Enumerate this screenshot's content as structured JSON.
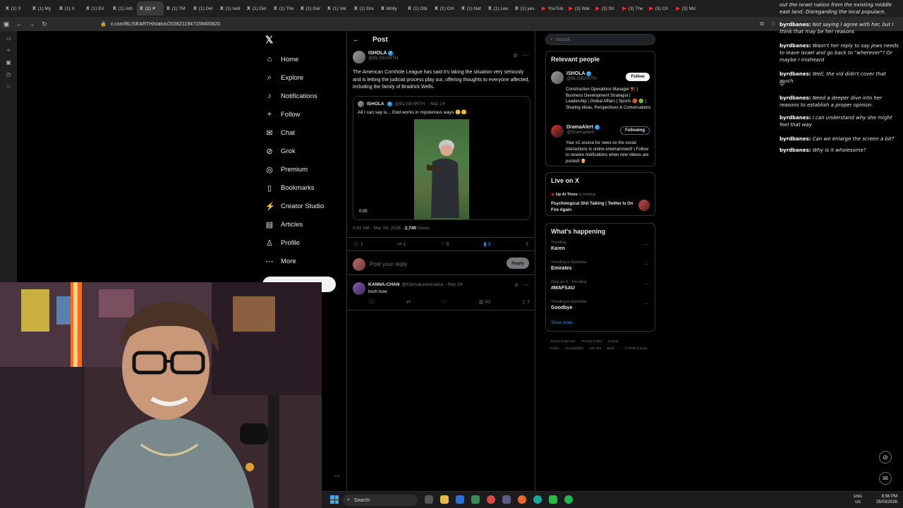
{
  "browser": {
    "tabs": [
      {
        "icon": "X",
        "label": "(1) X"
      },
      {
        "icon": "X",
        "label": "(1) My"
      },
      {
        "icon": "X",
        "label": "(1) X"
      },
      {
        "icon": "X",
        "label": "(1) Eri"
      },
      {
        "icon": "X",
        "label": "(1) Joh"
      },
      {
        "icon": "X",
        "label": "(1) ✕",
        "active": true
      },
      {
        "icon": "X",
        "label": "(1) TM"
      },
      {
        "icon": "X",
        "label": "(1) Del"
      },
      {
        "icon": "X",
        "label": "(1) redi"
      },
      {
        "icon": "X",
        "label": "(1) Del"
      },
      {
        "icon": "X",
        "label": "(1) The"
      },
      {
        "icon": "X",
        "label": "(1) Ger"
      },
      {
        "icon": "X",
        "label": "(1) Val"
      },
      {
        "icon": "X",
        "label": "(1) Dre"
      },
      {
        "icon": "X",
        "label": "Molly"
      },
      {
        "icon": "X",
        "label": "(1) Obi"
      },
      {
        "icon": "X",
        "label": "(1) Om"
      },
      {
        "icon": "X",
        "label": "(1) Nat"
      },
      {
        "icon": "X",
        "label": "(1) Lee"
      },
      {
        "icon": "X",
        "label": "(1) yes"
      },
      {
        "icon": "▶",
        "label": "YouTub",
        "yt": true
      },
      {
        "icon": "▶",
        "label": "(3) War",
        "yt": true
      },
      {
        "icon": "▶",
        "label": "(3) Str",
        "yt": true
      },
      {
        "icon": "▶",
        "label": "(3) The",
        "yt": true
      },
      {
        "icon": "▶",
        "label": "(3) Ch",
        "yt": true
      },
      {
        "icon": "▶",
        "label": "(3) Mic",
        "yt": true
      }
    ],
    "url": "x.com/BLISEARTH/status/2036211947159400820"
  },
  "nav": {
    "logo": "𝕏",
    "items": [
      {
        "icon": "⌂",
        "label": "Home"
      },
      {
        "icon": "⌕",
        "label": "Explore"
      },
      {
        "icon": "♪",
        "label": "Notifications"
      },
      {
        "icon": "+",
        "label": "Follow"
      },
      {
        "icon": "✉",
        "label": "Chat"
      },
      {
        "icon": "⊘",
        "label": "Grok"
      },
      {
        "icon": "◎",
        "label": "Premium"
      },
      {
        "icon": "▯",
        "label": "Bookmarks"
      },
      {
        "icon": "⚡",
        "label": "Creator Studio"
      },
      {
        "icon": "▤",
        "label": "Articles"
      },
      {
        "icon": "♙",
        "label": "Profile"
      },
      {
        "icon": "⋯",
        "label": "More"
      }
    ],
    "post_label": "Post"
  },
  "post": {
    "header_title": "Post",
    "author_name": "ISHOLA",
    "author_handle": "@BLISEARTH",
    "text": "The American Cornhole League has said it's taking the situation very seriously and is letting the judicial process play out, offering thoughts to everyone affected, including the family of Bradrick Wells.",
    "quote": {
      "author_name": "ISHOLA",
      "author_handle": "@BLISEARTH",
      "date": "· Mar 24",
      "text": "All I can say is... God works in mysterious ways 🙂🙂",
      "duration": "0:05"
    },
    "timestamp": "8:42 AM · Mar 24, 2026 · ",
    "views_count": "2,740",
    "views_label": " Views",
    "stats": {
      "replies": "1",
      "reposts": "1",
      "likes": "8",
      "bookmarks": "3"
    },
    "reply_placeholder": "Post your reply",
    "reply_button": "Reply",
    "reply": {
      "author_name": "KANNA-CHAN",
      "author_handle": "@Kannakamuisama",
      "date": "· Mar 24",
      "text": "bruh how",
      "views": "43"
    }
  },
  "sidebar": {
    "search_placeholder": "Search",
    "relevant_title": "Relevant people",
    "people": [
      {
        "name": "ISHOLA",
        "handle": "@BLISEARTH",
        "bio": "Construction Operations Manager 🏗️ | Business Development Strategist | Leadership | Global Affairs | Sports 🏀 🟢 | Sharing Ideas, Perspectives & Conversations",
        "button": "Follow"
      },
      {
        "name": "DramaAlert",
        "handle": "@DramaAlert",
        "bio": "Your #1 source for news on the social interactions in online entertainment! | Follow to receive notifications when new videos are posted! 🍿",
        "button": "Following"
      }
    ],
    "live_title": "Live on X",
    "live": {
      "host": "Up At Three",
      "hosting": "is hosting",
      "title": "Psychological Shit Talking | Twitter Is On Fire Again"
    },
    "happening_title": "What's happening",
    "trends": [
      {
        "context": "Trending",
        "name": "Karen"
      },
      {
        "context": "Trending in Australia",
        "name": "Emirates"
      },
      {
        "context": "Only on X · Trending",
        "name": "#MAFSAU"
      },
      {
        "context": "Trending in Australia",
        "name": "Goodbye"
      }
    ],
    "show_more": "Show more",
    "footer": [
      "Terms of Service",
      "Privacy Policy",
      "Cookie Policy",
      "Accessibility",
      "Ads info",
      "More ···",
      "© 2026 X Corp."
    ]
  },
  "chat": [
    {
      "user": "",
      "text": "out the israel nation from the existing middle east land. Disregarding the local populace."
    },
    {
      "user": "byrdbanes:",
      "text": "Not saying I agree with her, but I think that may be her reasons"
    },
    {
      "user": "byrdbanes:",
      "text": "Wasn't her reply to say jews needs to leave israel and go back to \"wherever\"? Or maybe I misheard"
    },
    {
      "user": "byrdbanes:",
      "text": "Well, the vid didn't cover that much"
    },
    {
      "user": "",
      "text": "😐"
    },
    {
      "user": "byrdbanes:",
      "text": "Need a deeper dive into her reasons to establish a proper opinion."
    },
    {
      "user": "byrdbanes:",
      "text": "I can understand why she might feel that way"
    },
    {
      "user": "byrdbanes:",
      "text": "Can we enlarge the screen a bit?"
    },
    {
      "user": "byrdbanes:",
      "text": "Why is it wholesome?"
    }
  ],
  "taskbar": {
    "search_label": "Search",
    "lang": "ENG",
    "region": "US",
    "time": "8:56 PM",
    "date": "25/03/2026"
  },
  "colors": {
    "accent": "#1d9bf0",
    "background": "#000000",
    "border": "#2f3336",
    "muted": "#71767b"
  }
}
